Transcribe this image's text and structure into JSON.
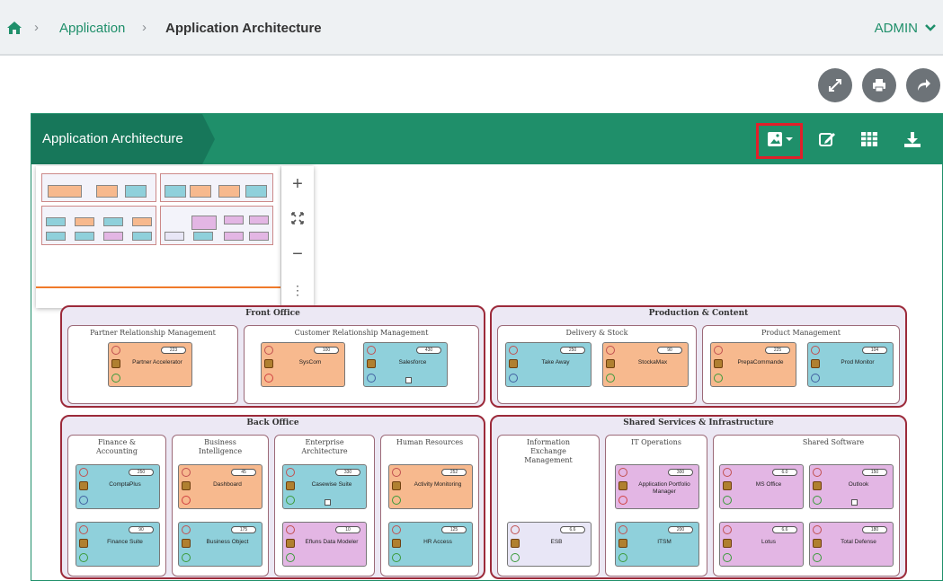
{
  "breadcrumb": {
    "items": [
      "Application",
      "Application Architecture"
    ]
  },
  "user": {
    "name": "ADMIN"
  },
  "panel": {
    "title": "Application Architecture"
  },
  "diagram": {
    "front_office": {
      "title": "Front Office",
      "prm": {
        "title": "Partner Relationship Management",
        "apps": [
          {
            "name": "Partner Accelerator",
            "badge": "223"
          }
        ]
      },
      "crm": {
        "title": "Customer Relationship Management",
        "apps": [
          {
            "name": "SysCom",
            "badge": "100"
          },
          {
            "name": "Salesforce",
            "badge": "430"
          }
        ]
      }
    },
    "production": {
      "title": "Production & Content",
      "delivery": {
        "title": "Delivery & Stock",
        "apps": [
          {
            "name": "Take Away",
            "badge": "250"
          },
          {
            "name": "StockaMax",
            "badge": "90"
          }
        ]
      },
      "product": {
        "title": "Product Management",
        "apps": [
          {
            "name": "PrepaCommande",
            "badge": "225"
          },
          {
            "name": "Prod Monitor",
            "badge": "104"
          }
        ]
      }
    },
    "back_office": {
      "title": "Back Office",
      "finance": {
        "title": "Finance & Accounting",
        "apps": [
          {
            "name": "ComptaPlus",
            "badge": "250"
          },
          {
            "name": "Finance Suite",
            "badge": "90"
          }
        ]
      },
      "bi": {
        "title": "Business Intelligence",
        "apps": [
          {
            "name": "Dashboard",
            "badge": "45"
          },
          {
            "name": "Business Object",
            "badge": "175"
          }
        ]
      },
      "ea": {
        "title": "Enterprise Architecture",
        "apps": [
          {
            "name": "Casewise Suite",
            "badge": "330"
          },
          {
            "name": "Efluns Data Modeler",
            "badge": "10"
          }
        ]
      },
      "hr": {
        "title": "Human Resources",
        "apps": [
          {
            "name": "Activity Monitoring",
            "badge": "252"
          },
          {
            "name": "HR Access",
            "badge": "125"
          }
        ]
      }
    },
    "shared": {
      "title": "Shared Services & Infrastructure",
      "iem": {
        "title": "Information Exchange Management",
        "apps": [
          {
            "name": "ESB",
            "badge": "6.6"
          }
        ]
      },
      "itops": {
        "title": "IT Operations",
        "apps": [
          {
            "name": "Application Portfolio Manager",
            "badge": "300"
          },
          {
            "name": "ITSM",
            "badge": "200"
          }
        ]
      },
      "software": {
        "title": "Shared Software",
        "apps": [
          {
            "name": "MS Office",
            "badge": "6.0"
          },
          {
            "name": "Outlook",
            "badge": "150"
          },
          {
            "name": "Lotus",
            "badge": "6.6"
          },
          {
            "name": "Total Defense",
            "badge": "180"
          }
        ]
      }
    }
  },
  "colors": {
    "accent": "#1f8f6a",
    "header_dark": "#17775a",
    "highlight": "#e0202a",
    "group_border": "#9c2a3a"
  }
}
